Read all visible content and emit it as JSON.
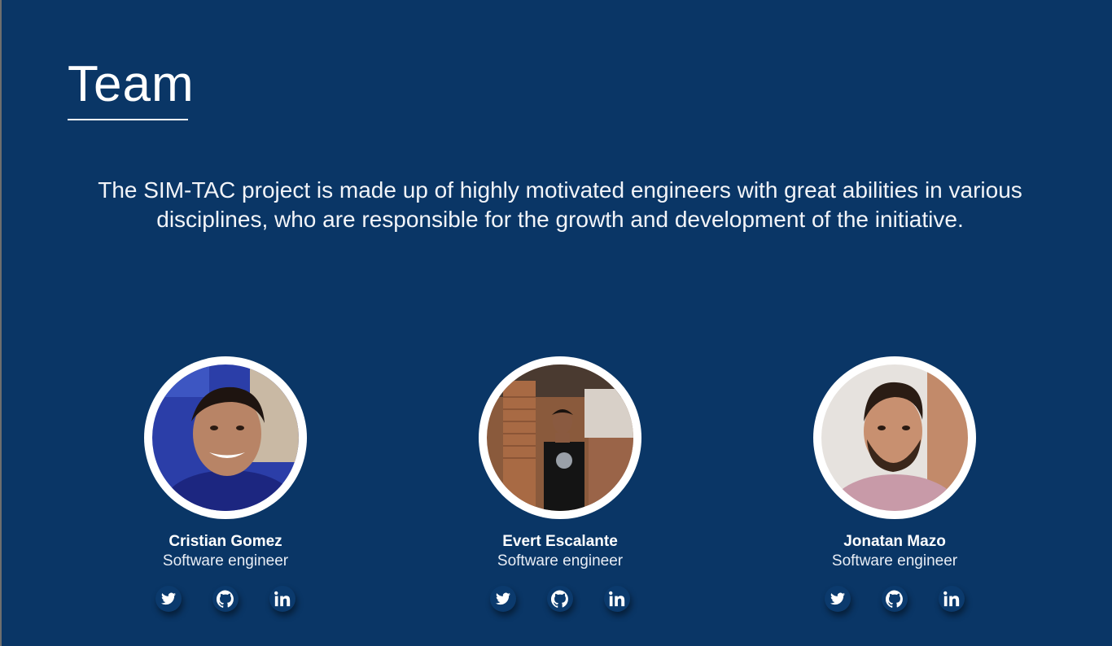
{
  "page": {
    "title": "Team",
    "intro": "The SIM-TAC project is made up of highly motivated engineers with great abilities in various disciplines, who are responsible for the growth and development of the initiative."
  },
  "colors": {
    "background": "#0a3666",
    "text": "#ffffff",
    "avatar_ring": "#ffffff"
  },
  "team": [
    {
      "name": "Cristian Gomez",
      "role": "Software engineer",
      "socials": [
        "twitter-icon",
        "github-icon",
        "linkedin-icon"
      ]
    },
    {
      "name": "Evert Escalante",
      "role": "Software engineer",
      "socials": [
        "twitter-icon",
        "github-icon",
        "linkedin-icon"
      ]
    },
    {
      "name": "Jonatan Mazo",
      "role": "Software engineer",
      "socials": [
        "twitter-icon",
        "github-icon",
        "linkedin-icon"
      ]
    }
  ],
  "icons": {
    "twitter": "twitter-icon",
    "github": "github-icon",
    "linkedin": "linkedin-icon"
  }
}
